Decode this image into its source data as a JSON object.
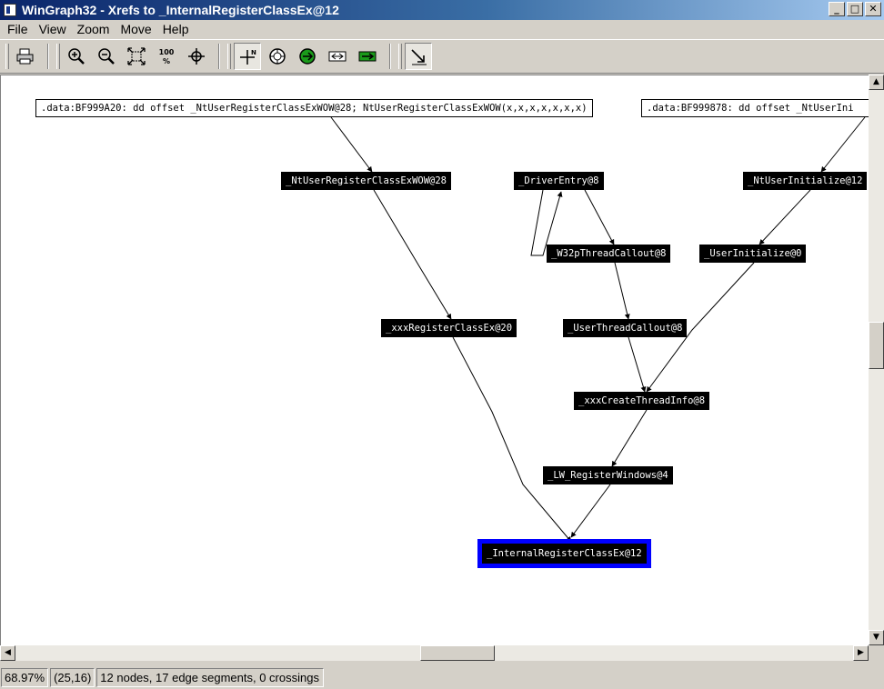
{
  "window": {
    "title": "WinGraph32 - Xrefs to _InternalRegisterClassEx@12",
    "minimize_glyph": "_",
    "maximize_glyph": "□",
    "close_glyph": "✕"
  },
  "menu": {
    "items": [
      "File",
      "View",
      "Zoom",
      "Move",
      "Help"
    ]
  },
  "toolbar": {
    "icons": [
      "print-icon",
      "zoom-in-icon",
      "zoom-out-icon",
      "fit-window-icon",
      "zoom-100-icon",
      "center-icon",
      "move-north-icon",
      "compass-icon",
      "move-green-icon",
      "move-fast-icon",
      "move-back-icon",
      "follow-edge-icon"
    ],
    "zoom_100_label": "100\n%"
  },
  "graph": {
    "nodes": [
      {
        "id": "data1",
        "label": ".data:BF999A20: dd offset _NtUserRegisterClassExWOW@28; NtUserRegisterClassExWOW(x,x,x,x,x,x,x)",
        "kind": "data"
      },
      {
        "id": "data2",
        "label": ".data:BF999878: dd offset _NtUserIni",
        "kind": "data"
      },
      {
        "id": "ntuserregister",
        "label": "_NtUserRegisterClassExWOW@28",
        "kind": "func"
      },
      {
        "id": "driverentry",
        "label": "_DriverEntry@8",
        "kind": "func"
      },
      {
        "id": "ntuserinitialize",
        "label": "_NtUserInitialize@12",
        "kind": "func"
      },
      {
        "id": "w32pthread",
        "label": "_W32pThreadCallout@8",
        "kind": "func"
      },
      {
        "id": "userinitialize",
        "label": "_UserInitialize@0",
        "kind": "func"
      },
      {
        "id": "xxxregister",
        "label": "_xxxRegisterClassEx@20",
        "kind": "func"
      },
      {
        "id": "userthread",
        "label": "_UserThreadCallout@8",
        "kind": "func"
      },
      {
        "id": "xxxcreatethread",
        "label": "_xxxCreateThreadInfo@8",
        "kind": "func"
      },
      {
        "id": "lwregister",
        "label": "_LW_RegisterWindows@4",
        "kind": "func"
      },
      {
        "id": "internalregister",
        "label": "_InternalRegisterClassEx@12",
        "kind": "selected"
      }
    ]
  },
  "scrollbars": {
    "up_glyph": "▲",
    "down_glyph": "▼",
    "left_glyph": "◀",
    "right_glyph": "▶"
  },
  "status": {
    "zoom": "68.97%",
    "position": "(25,16)",
    "summary": "12 nodes, 17 edge segments, 0 crossings"
  }
}
